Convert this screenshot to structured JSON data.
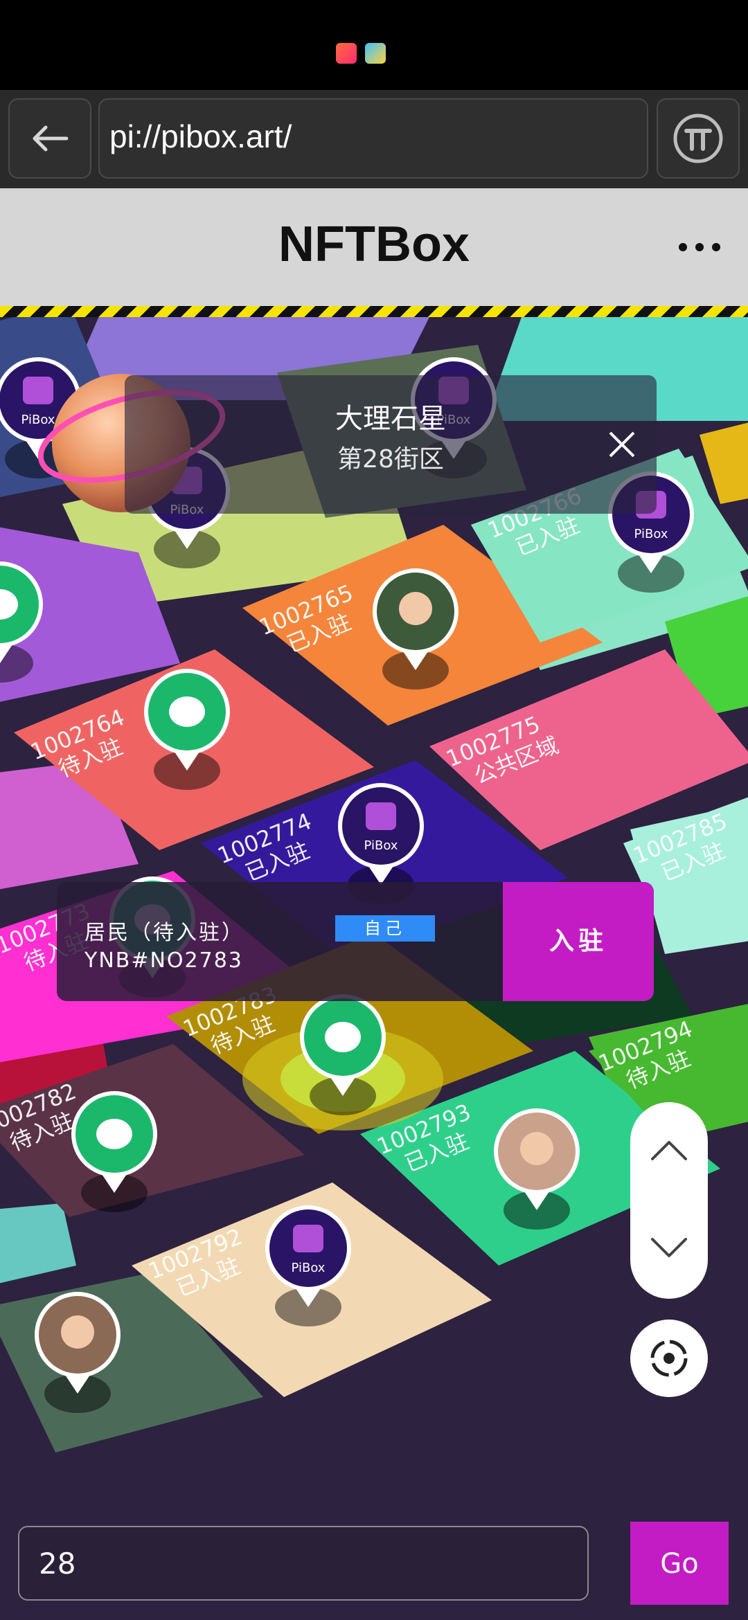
{
  "browser": {
    "url": "pi://pibox.art/"
  },
  "app": {
    "title": "NFTBox"
  },
  "district": {
    "name": "大理石星",
    "sub": "第28街区"
  },
  "tiles": [
    {
      "id": "1002765",
      "status": "已入驻",
      "color": "#f5853a"
    },
    {
      "id": "1002764",
      "status": "待入驻",
      "color": "#ef6462"
    },
    {
      "id": "1002775",
      "status": "公共区域",
      "color": "#ee638e"
    },
    {
      "id": "1002774",
      "status": "已入驻",
      "color": "#35199c"
    },
    {
      "id": "1002773",
      "status": "待入驻",
      "color": "#ff2fd1"
    },
    {
      "id": "1002783",
      "status": "待入驻",
      "color": "#b28d06"
    },
    {
      "id": "1002782",
      "status": "待入驻",
      "color": "#5a3347"
    },
    {
      "id": "1002793",
      "status": "已入驻",
      "color": "#2ecf8b"
    },
    {
      "id": "1002794",
      "status": "待入驻",
      "color": "#47b930"
    },
    {
      "id": "1002792",
      "status": "已入驻",
      "color": "#f2d9b4"
    },
    {
      "id": "1002766",
      "status": "已入驻",
      "color": "#86e5c3"
    },
    {
      "id": "1002785",
      "status": "已入驻",
      "color": "#a8f0dc"
    }
  ],
  "pin_badge": "PiBox",
  "resident": {
    "label": "居民（待入驻）",
    "badge": "自己",
    "id": "YNB#NO2783",
    "action": "入驻"
  },
  "search": {
    "value": "28",
    "go_label": "Go"
  },
  "colors": {
    "accent": "#c41cc4",
    "badge_blue": "#2f8cf6",
    "pin_green": "#1bb86c"
  }
}
